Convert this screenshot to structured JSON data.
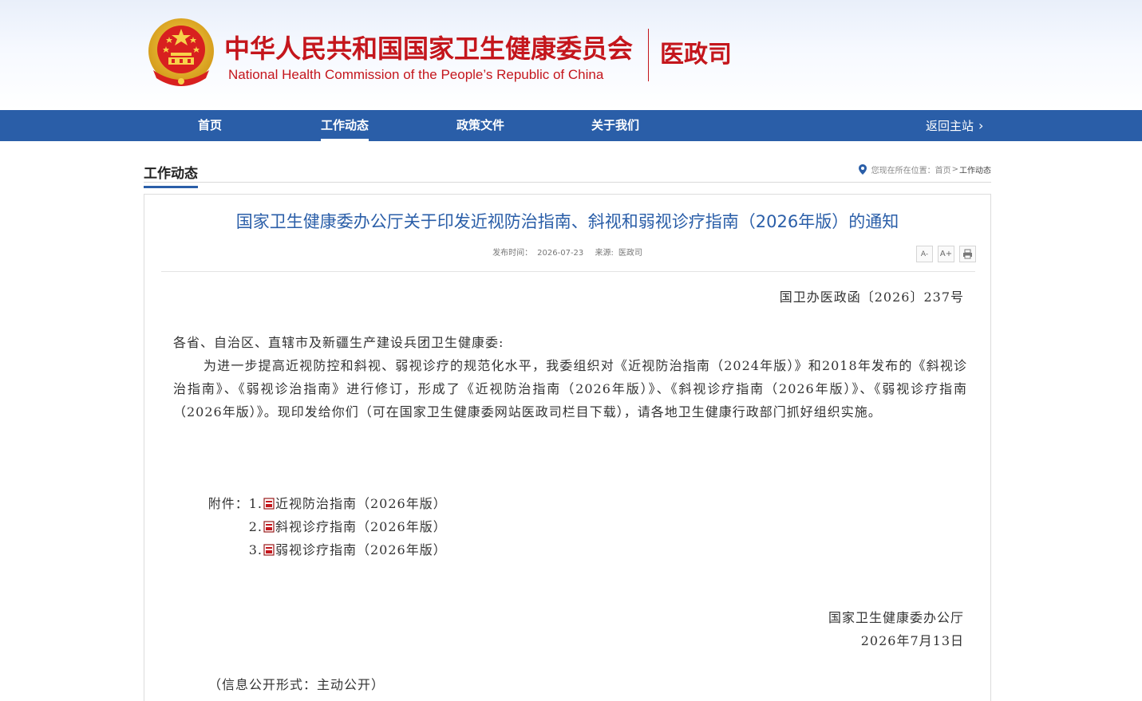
{
  "header": {
    "title_cn": "中华人民共和国国家卫生健康委员会",
    "title_en": "National Health Commission of the People’s  Republic of China",
    "department": "医政司",
    "emblem_icon": "national-emblem-icon"
  },
  "nav": {
    "items": [
      {
        "label": "首页"
      },
      {
        "label": "工作动态"
      },
      {
        "label": "政策文件"
      },
      {
        "label": "关于我们"
      }
    ],
    "active": "工作动态",
    "back_label": "返回主站",
    "back_icon": "chevron-right-icon"
  },
  "section": {
    "title": "工作动态",
    "breadcrumb": {
      "prefix": "您现在所在位置：",
      "home": "首页",
      "separator": ">",
      "current": "工作动态"
    }
  },
  "article": {
    "title": "国家卫生健康委办公厅关于印发近视防治指南、斜视和弱视诊疗指南（2026年版）的通知",
    "meta": {
      "date_label": "发布时间：",
      "date": "2026-07-23",
      "source_label": "来源:",
      "source": "医政司"
    },
    "tools": {
      "font_smaller": "A-",
      "font_larger": "A+",
      "print_icon": "print-icon"
    },
    "doc_number": "国卫办医政函〔2026〕237号",
    "addressee": "各省、自治区、直辖市及新疆生产建设兵团卫生健康委:",
    "paragraph": "为进一步提高近视防控和斜视、弱视诊疗的规范化水平，我委组织对《近视防治指南（2024年版）》和2018年发布的《斜视诊治指南》、《弱视诊治指南》进行修订，形成了《近视防治指南（2026年版）》、《斜视诊疗指南（2026年版）》、《弱视诊疗指南（2026年版）》。现印发给你们（可在国家卫生健康委网站医政司栏目下载），请各地卫生健康行政部门抓好组织实施。",
    "attachments": {
      "label": "附件：",
      "items": [
        {
          "num": "1.",
          "title": "近视防治指南（2026年版）"
        },
        {
          "num": "2.",
          "title": "斜视诊疗指南（2026年版）"
        },
        {
          "num": "3.",
          "title": "弱视诊疗指南（2026年版）"
        }
      ]
    },
    "signature": {
      "org": "国家卫生健康委办公厅",
      "date": "2026年7月13日"
    },
    "disclosure": "（信息公开形式：主动公开）"
  },
  "colors": {
    "brand_red": "#c4161c",
    "nav_blue": "#2a5ea8",
    "title_blue": "#2a5ea8"
  }
}
